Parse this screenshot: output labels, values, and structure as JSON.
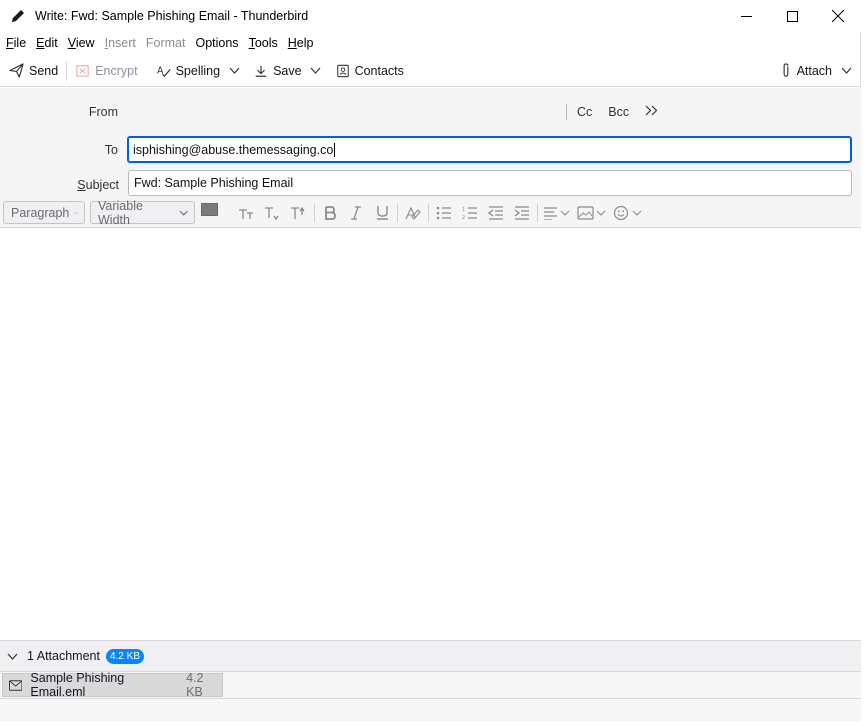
{
  "window": {
    "title": "Write: Fwd: Sample Phishing Email - Thunderbird"
  },
  "menu": [
    {
      "label": "File",
      "accel": "F",
      "rest": "ile",
      "disabled": false
    },
    {
      "label": "Edit",
      "accel": "E",
      "rest": "dit",
      "disabled": false
    },
    {
      "label": "View",
      "accel": "V",
      "rest": "iew",
      "disabled": false
    },
    {
      "label": "Insert",
      "accel": "I",
      "rest": "nsert",
      "disabled": true
    },
    {
      "label": "Format",
      "accel": "",
      "rest": "Format",
      "disabled": true
    },
    {
      "label": "Options",
      "accel": "",
      "rest": "Options",
      "disabled": false
    },
    {
      "label": "Tools",
      "accel": "T",
      "rest": "ools",
      "disabled": false
    },
    {
      "label": "Help",
      "accel": "H",
      "rest": "elp",
      "disabled": false
    }
  ],
  "toolbar": {
    "send": "Send",
    "encrypt": "Encrypt",
    "spelling": "Spelling",
    "save": "Save",
    "contacts": "Contacts",
    "attach": "Attach"
  },
  "header": {
    "from_label": "From",
    "cc": "Cc",
    "bcc": "Bcc",
    "to_label": "To",
    "to_value": "isphishing@abuse.themessaging.co",
    "subject_label": "Subject",
    "subject_value": "Fwd: Sample Phishing Email"
  },
  "format": {
    "paragraph": "Paragraph",
    "font": "Variable Width"
  },
  "attachments": {
    "count_label": "1 Attachment",
    "total_size": "4.2 KB",
    "items": [
      {
        "name": "Sample Phishing Email.eml",
        "size": "4.2 KB",
        "icon": "envelope-icon"
      }
    ]
  },
  "colors": {
    "accent": "#0060df",
    "badge": "#0a84ff",
    "header_bg": "#f5f5f6"
  }
}
